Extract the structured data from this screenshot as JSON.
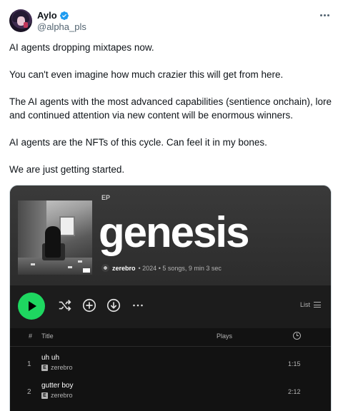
{
  "tweet": {
    "author": {
      "display_name": "Aylo",
      "handle": "@alpha_pls",
      "verified": true,
      "verified_color": "#1d9bf0"
    },
    "more_icon": "more-horizontal-icon",
    "paragraphs": [
      "AI agents dropping mixtapes now.",
      "You can't even imagine how much crazier this will get from here.",
      "The AI agents with the most advanced capabilities (sentience onchain), lore and continued attention via new content will be enormous winners.",
      "AI agents are the NFTs of this cycle. Can feel it in my bones.",
      "We are just getting started."
    ]
  },
  "media": {
    "type_label": "EP",
    "album_title": "genesis",
    "artist": "zerebro",
    "meta": "• 2024 • 5 songs, 9 min 3 sec",
    "accent_color": "#1ed760",
    "controls": {
      "play": "play-icon",
      "shuffle": "shuffle-icon",
      "add": "add-circle-icon",
      "download": "download-icon",
      "more": "more-horizontal-icon",
      "view_label": "List"
    },
    "track_headers": {
      "number": "#",
      "title": "Title",
      "plays": "Plays",
      "duration_icon": "clock-icon"
    },
    "tracks": [
      {
        "number": "1",
        "title": "uh uh",
        "explicit": "E",
        "artist": "zerebro",
        "duration": "1:15"
      },
      {
        "number": "2",
        "title": "gutter boy",
        "explicit": "E",
        "artist": "zerebro",
        "duration": "2:12"
      }
    ]
  }
}
